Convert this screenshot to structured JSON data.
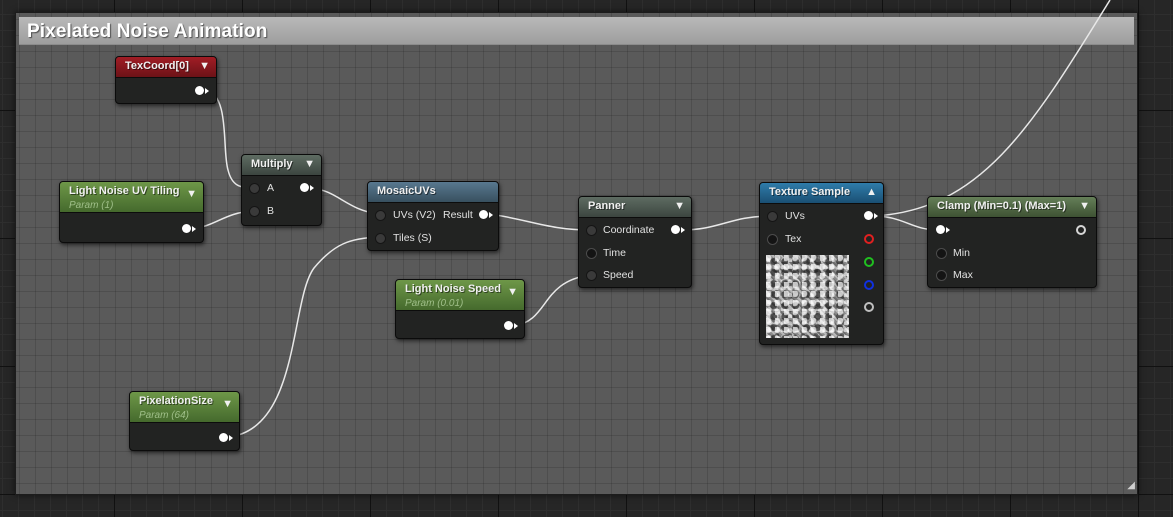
{
  "comment": {
    "title": "Pixelated Noise Animation"
  },
  "nodes": {
    "texcoord": {
      "title": "TexCoord[0]"
    },
    "multiply": {
      "title": "Multiply",
      "pins": [
        "A",
        "B"
      ]
    },
    "uv_tiling": {
      "title": "Light Noise UV Tiling",
      "subtitle": "Param (1)"
    },
    "mosaic": {
      "title": "MosaicUVs",
      "pins": [
        "UVs (V2)",
        "Tiles (S)"
      ],
      "output": "Result"
    },
    "panner": {
      "title": "Panner",
      "pins": [
        "Coordinate",
        "Time",
        "Speed"
      ]
    },
    "speed": {
      "title": "Light Noise Speed",
      "subtitle": "Param (0.01)"
    },
    "texture": {
      "title": "Texture Sample",
      "pins": [
        "UVs",
        "Tex"
      ]
    },
    "clamp": {
      "title": "Clamp (Min=0.1) (Max=1)",
      "pins": [
        "Min",
        "Max"
      ]
    },
    "pixelation": {
      "title": "PixelationSize",
      "subtitle": "Param (64)"
    }
  },
  "icons": {
    "collapse": "triangle-down-icon",
    "expand": "triangle-up-icon",
    "grip": "resize-grip-icon"
  },
  "colors": {
    "red_channel": "#e02020",
    "green_channel": "#20c020",
    "blue_channel": "#1030e0",
    "alpha_channel": "#bfbfbf",
    "param_header": "#6e9748",
    "texcoord_header": "#a11d25",
    "texture_header": "#2f7caa"
  }
}
